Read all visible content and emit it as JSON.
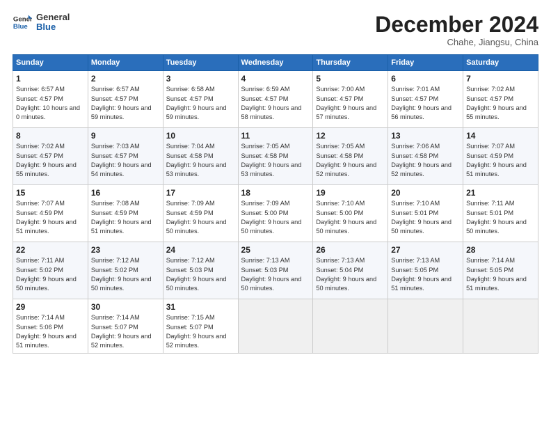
{
  "header": {
    "logo_general": "General",
    "logo_blue": "Blue",
    "month": "December 2024",
    "location": "Chahe, Jiangsu, China"
  },
  "weekdays": [
    "Sunday",
    "Monday",
    "Tuesday",
    "Wednesday",
    "Thursday",
    "Friday",
    "Saturday"
  ],
  "weeks": [
    [
      {
        "day": "1",
        "sunrise": "6:57 AM",
        "sunset": "4:57 PM",
        "daylight": "10 hours and 0 minutes."
      },
      {
        "day": "2",
        "sunrise": "6:57 AM",
        "sunset": "4:57 PM",
        "daylight": "9 hours and 59 minutes."
      },
      {
        "day": "3",
        "sunrise": "6:58 AM",
        "sunset": "4:57 PM",
        "daylight": "9 hours and 59 minutes."
      },
      {
        "day": "4",
        "sunrise": "6:59 AM",
        "sunset": "4:57 PM",
        "daylight": "9 hours and 58 minutes."
      },
      {
        "day": "5",
        "sunrise": "7:00 AM",
        "sunset": "4:57 PM",
        "daylight": "9 hours and 57 minutes."
      },
      {
        "day": "6",
        "sunrise": "7:01 AM",
        "sunset": "4:57 PM",
        "daylight": "9 hours and 56 minutes."
      },
      {
        "day": "7",
        "sunrise": "7:02 AM",
        "sunset": "4:57 PM",
        "daylight": "9 hours and 55 minutes."
      }
    ],
    [
      {
        "day": "8",
        "sunrise": "7:02 AM",
        "sunset": "4:57 PM",
        "daylight": "9 hours and 55 minutes."
      },
      {
        "day": "9",
        "sunrise": "7:03 AM",
        "sunset": "4:57 PM",
        "daylight": "9 hours and 54 minutes."
      },
      {
        "day": "10",
        "sunrise": "7:04 AM",
        "sunset": "4:58 PM",
        "daylight": "9 hours and 53 minutes."
      },
      {
        "day": "11",
        "sunrise": "7:05 AM",
        "sunset": "4:58 PM",
        "daylight": "9 hours and 53 minutes."
      },
      {
        "day": "12",
        "sunrise": "7:05 AM",
        "sunset": "4:58 PM",
        "daylight": "9 hours and 52 minutes."
      },
      {
        "day": "13",
        "sunrise": "7:06 AM",
        "sunset": "4:58 PM",
        "daylight": "9 hours and 52 minutes."
      },
      {
        "day": "14",
        "sunrise": "7:07 AM",
        "sunset": "4:59 PM",
        "daylight": "9 hours and 51 minutes."
      }
    ],
    [
      {
        "day": "15",
        "sunrise": "7:07 AM",
        "sunset": "4:59 PM",
        "daylight": "9 hours and 51 minutes."
      },
      {
        "day": "16",
        "sunrise": "7:08 AM",
        "sunset": "4:59 PM",
        "daylight": "9 hours and 51 minutes."
      },
      {
        "day": "17",
        "sunrise": "7:09 AM",
        "sunset": "4:59 PM",
        "daylight": "9 hours and 50 minutes."
      },
      {
        "day": "18",
        "sunrise": "7:09 AM",
        "sunset": "5:00 PM",
        "daylight": "9 hours and 50 minutes."
      },
      {
        "day": "19",
        "sunrise": "7:10 AM",
        "sunset": "5:00 PM",
        "daylight": "9 hours and 50 minutes."
      },
      {
        "day": "20",
        "sunrise": "7:10 AM",
        "sunset": "5:01 PM",
        "daylight": "9 hours and 50 minutes."
      },
      {
        "day": "21",
        "sunrise": "7:11 AM",
        "sunset": "5:01 PM",
        "daylight": "9 hours and 50 minutes."
      }
    ],
    [
      {
        "day": "22",
        "sunrise": "7:11 AM",
        "sunset": "5:02 PM",
        "daylight": "9 hours and 50 minutes."
      },
      {
        "day": "23",
        "sunrise": "7:12 AM",
        "sunset": "5:02 PM",
        "daylight": "9 hours and 50 minutes."
      },
      {
        "day": "24",
        "sunrise": "7:12 AM",
        "sunset": "5:03 PM",
        "daylight": "9 hours and 50 minutes."
      },
      {
        "day": "25",
        "sunrise": "7:13 AM",
        "sunset": "5:03 PM",
        "daylight": "9 hours and 50 minutes."
      },
      {
        "day": "26",
        "sunrise": "7:13 AM",
        "sunset": "5:04 PM",
        "daylight": "9 hours and 50 minutes."
      },
      {
        "day": "27",
        "sunrise": "7:13 AM",
        "sunset": "5:05 PM",
        "daylight": "9 hours and 51 minutes."
      },
      {
        "day": "28",
        "sunrise": "7:14 AM",
        "sunset": "5:05 PM",
        "daylight": "9 hours and 51 minutes."
      }
    ],
    [
      {
        "day": "29",
        "sunrise": "7:14 AM",
        "sunset": "5:06 PM",
        "daylight": "9 hours and 51 minutes."
      },
      {
        "day": "30",
        "sunrise": "7:14 AM",
        "sunset": "5:07 PM",
        "daylight": "9 hours and 52 minutes."
      },
      {
        "day": "31",
        "sunrise": "7:15 AM",
        "sunset": "5:07 PM",
        "daylight": "9 hours and 52 minutes."
      },
      null,
      null,
      null,
      null
    ]
  ]
}
